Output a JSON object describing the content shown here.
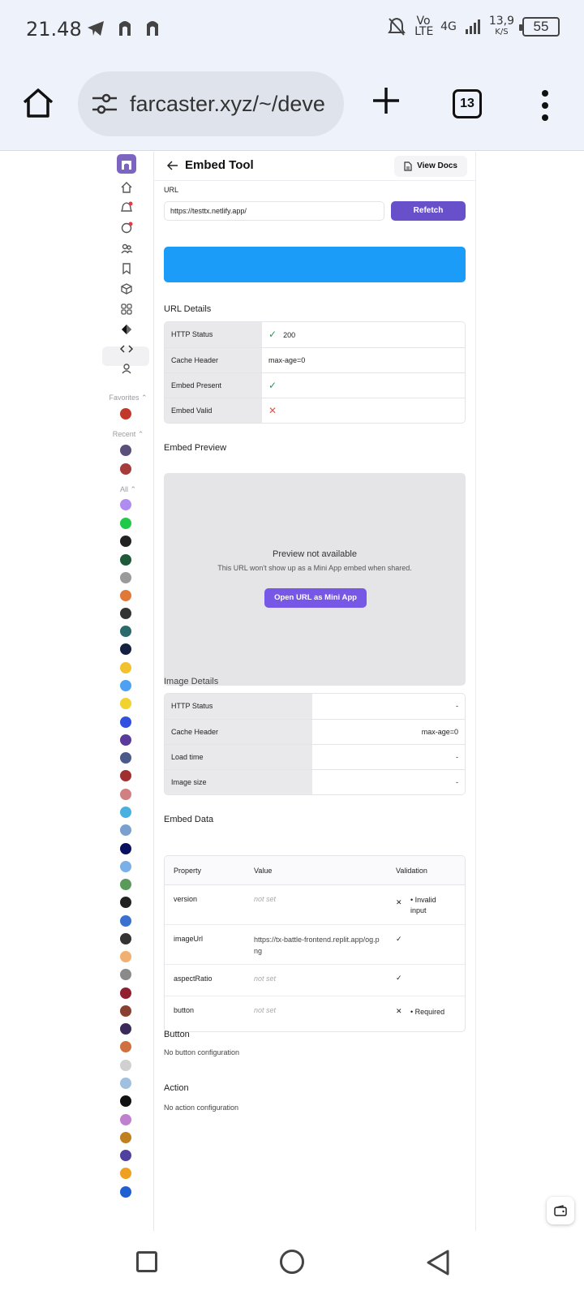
{
  "status_bar": {
    "time": "21.48",
    "network": "Vo LTE",
    "signal": "4G",
    "speed": "13,9",
    "speed_unit": "K/S",
    "battery": "55"
  },
  "browser": {
    "url": "farcaster.xyz/~/deve",
    "tab_count": "13"
  },
  "sidebar": {
    "favorites_label": "Favorites",
    "recent_label": "Recent",
    "all_label": "All"
  },
  "header": {
    "title": "Embed Tool",
    "docs_label": "View Docs"
  },
  "form": {
    "url_label": "URL",
    "url_value": "https://testtx.netlify.app/",
    "refetch_label": "Refetch"
  },
  "url_details": {
    "title": "URL Details",
    "rows": [
      {
        "key": "HTTP Status",
        "value": "200"
      },
      {
        "key": "Cache Header",
        "value": "max-age=0"
      },
      {
        "key": "Embed Present",
        "value": ""
      },
      {
        "key": "Embed Valid",
        "value": ""
      }
    ]
  },
  "preview": {
    "title": "Embed Preview",
    "heading": "Preview not available",
    "subtitle": "This URL won't show up as a Mini App embed when shared.",
    "button": "Open URL as Mini App"
  },
  "image_details": {
    "title": "Image Details",
    "rows": [
      {
        "key": "HTTP Status",
        "value": "-"
      },
      {
        "key": "Cache Header",
        "value": "max-age=0"
      },
      {
        "key": "Load time",
        "value": "-"
      },
      {
        "key": "Image size",
        "value": "-"
      }
    ]
  },
  "embed_data": {
    "title": "Embed Data",
    "headers": [
      "Property",
      "Value",
      "Validation"
    ],
    "rows": [
      {
        "property": "version",
        "value": "not set",
        "validation": "Invalid input"
      },
      {
        "property": "imageUrl",
        "value": "https://tx-battle-frontend.replit.app/og.png",
        "validation": ""
      },
      {
        "property": "aspectRatio",
        "value": "not set",
        "validation": ""
      },
      {
        "property": "button",
        "value": "not set",
        "validation": "Required"
      }
    ]
  },
  "button_section": {
    "title": "Button",
    "text": "No button configuration"
  },
  "action_section": {
    "title": "Action",
    "text": "No action configuration"
  },
  "colors": {
    "accent": "#6750c9",
    "banner": "#1a9cf8",
    "success": "#1f9d55",
    "error": "#e0584c"
  }
}
